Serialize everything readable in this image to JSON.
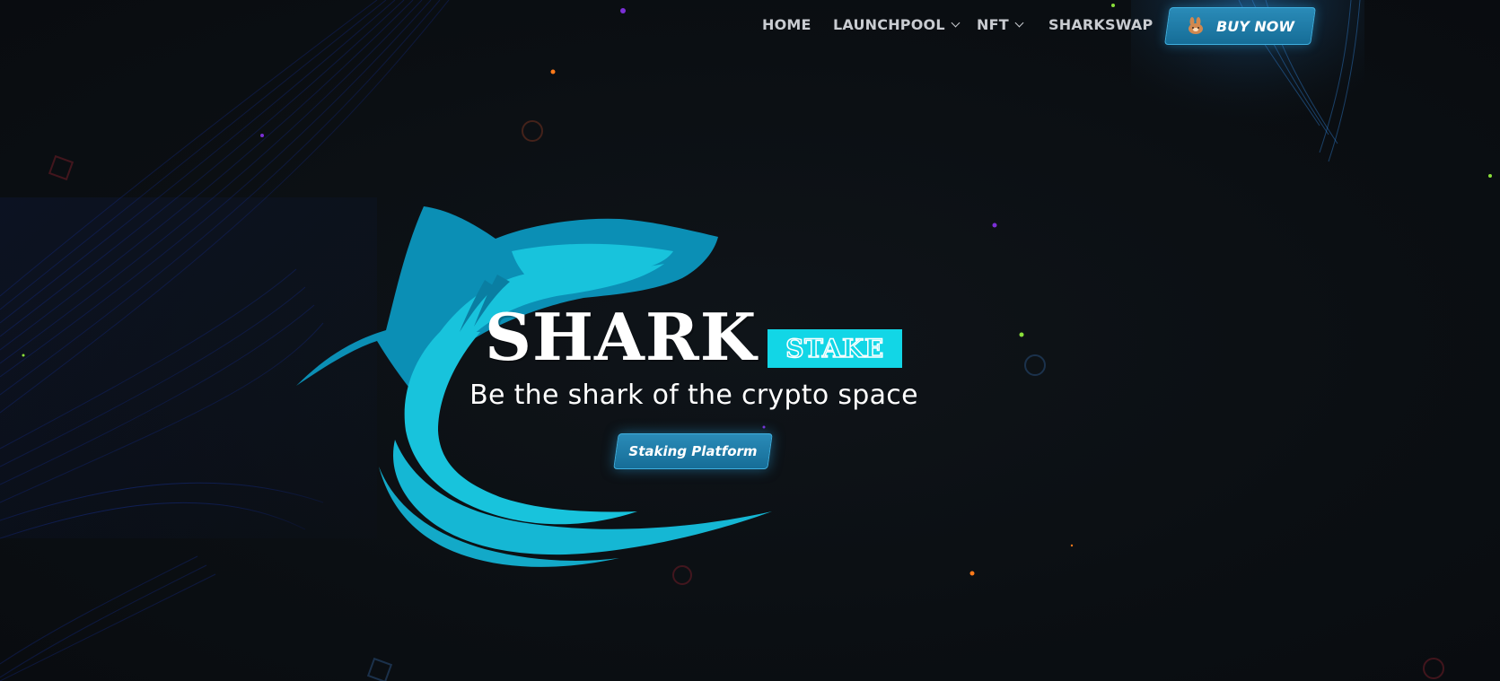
{
  "nav": {
    "items": [
      {
        "label": "HOME",
        "has_dropdown": false
      },
      {
        "label": "LAUNCHPOOL",
        "has_dropdown": true
      },
      {
        "label": "NFT",
        "has_dropdown": true
      },
      {
        "label": "SHARKSWAP",
        "has_dropdown": false
      }
    ],
    "buy_button": {
      "label": "BUY NOW",
      "icon": "pancakeswap-bunny-icon"
    }
  },
  "hero": {
    "logo_icon": "shark-icon",
    "title": "SHARK",
    "badge": "STAKE",
    "tagline": "Be the shark of the crypto space",
    "cta_label": "Staking Platform"
  },
  "colors": {
    "background": "#0c1014",
    "accent_cyan": "#12d6e6",
    "shark_blue": "#0b8fb5",
    "shark_light": "#18c3dc",
    "button_blue": "#1f7eaa",
    "nav_text": "#c9ccd1"
  }
}
